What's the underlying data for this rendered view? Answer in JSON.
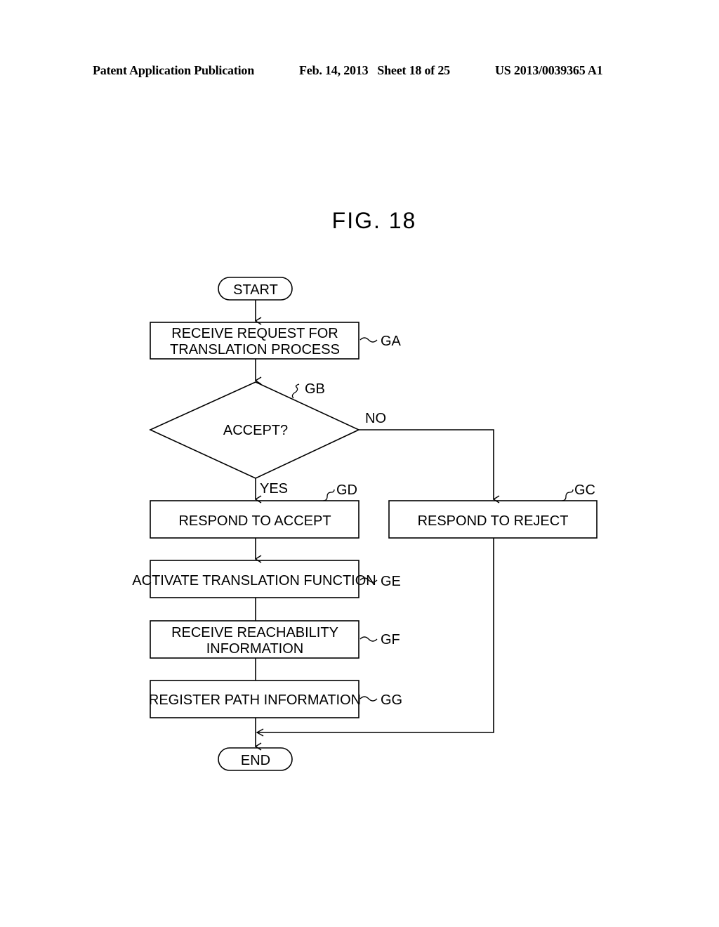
{
  "header": {
    "left": "Patent Application Publication",
    "middle": "Feb. 14, 2013   Sheet 18 of 25",
    "right": "US 2013/0039365 A1"
  },
  "figure": {
    "title": "FIG. 18"
  },
  "flowchart": {
    "start": "START",
    "end": "END",
    "steps": {
      "GA": {
        "ref": "GA",
        "lines": [
          "RECEIVE REQUEST FOR",
          "TRANSLATION PROCESS"
        ]
      },
      "GB": {
        "ref": "GB",
        "lines": [
          "ACCEPT?"
        ],
        "yes_label": "YES",
        "no_label": "NO"
      },
      "GC": {
        "ref": "GC",
        "lines": [
          "RESPOND TO REJECT"
        ]
      },
      "GD": {
        "ref": "GD",
        "lines": [
          "RESPOND TO ACCEPT"
        ]
      },
      "GE": {
        "ref": "GE",
        "lines": [
          "ACTIVATE TRANSLATION FUNCTION"
        ]
      },
      "GF": {
        "ref": "GF",
        "lines": [
          "RECEIVE REACHABILITY",
          "INFORMATION"
        ]
      },
      "GG": {
        "ref": "GG",
        "lines": [
          "REGISTER PATH INFORMATION"
        ]
      }
    }
  }
}
